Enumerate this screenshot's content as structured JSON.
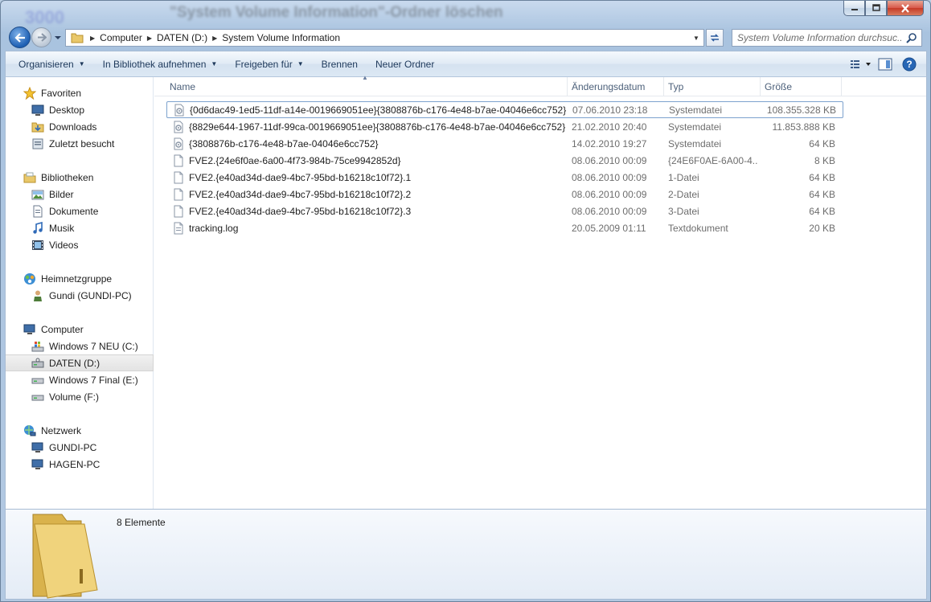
{
  "window": {
    "title": "\"System Volume Information\"-Ordner löschen",
    "background_logo": "3000"
  },
  "address": {
    "crumbs": [
      "Computer",
      "DATEN (D:)",
      "System Volume Information"
    ]
  },
  "search": {
    "placeholder": "System Volume Information durchsuc..."
  },
  "toolbar": {
    "items": [
      {
        "label": "Organisieren",
        "has_dropdown": true
      },
      {
        "label": "In Bibliothek aufnehmen",
        "has_dropdown": true
      },
      {
        "label": "Freigeben für",
        "has_dropdown": true
      },
      {
        "label": "Brennen",
        "has_dropdown": false
      },
      {
        "label": "Neuer Ordner",
        "has_dropdown": false
      }
    ]
  },
  "nav": {
    "favorites": {
      "label": "Favoriten",
      "items": [
        "Desktop",
        "Downloads",
        "Zuletzt besucht"
      ]
    },
    "libraries": {
      "label": "Bibliotheken",
      "items": [
        "Bilder",
        "Dokumente",
        "Musik",
        "Videos"
      ]
    },
    "homegroup": {
      "label": "Heimnetzgruppe",
      "items": [
        "Gundi (GUNDI-PC)"
      ]
    },
    "computer": {
      "label": "Computer",
      "items": [
        "Windows 7 NEU (C:)",
        "DATEN (D:)",
        "Windows 7 Final (E:)",
        "Volume (F:)"
      ],
      "selected": "DATEN (D:)"
    },
    "network": {
      "label": "Netzwerk",
      "items": [
        "GUNDI-PC",
        "HAGEN-PC"
      ]
    }
  },
  "columns": {
    "name": "Name",
    "date": "Änderungsdatum",
    "type": "Typ",
    "size": "Größe"
  },
  "files": [
    {
      "name": "{0d6dac49-1ed5-11df-a14e-0019669051ee}{3808876b-c176-4e48-b7ae-04046e6cc752}",
      "date": "07.06.2010 23:18",
      "type": "Systemdatei",
      "size": "108.355.328 KB",
      "icon": "system-file-icon"
    },
    {
      "name": "{8829e644-1967-11df-99ca-0019669051ee}{3808876b-c176-4e48-b7ae-04046e6cc752}",
      "date": "21.02.2010 20:40",
      "type": "Systemdatei",
      "size": "11.853.888 KB",
      "icon": "system-file-icon"
    },
    {
      "name": "{3808876b-c176-4e48-b7ae-04046e6cc752}",
      "date": "14.02.2010 19:27",
      "type": "Systemdatei",
      "size": "64 KB",
      "icon": "system-file-icon"
    },
    {
      "name": "FVE2.{24e6f0ae-6a00-4f73-984b-75ce9942852d}",
      "date": "08.06.2010 00:09",
      "type": "{24E6F0AE-6A00-4...",
      "size": "8 KB",
      "icon": "file-icon"
    },
    {
      "name": "FVE2.{e40ad34d-dae9-4bc7-95bd-b16218c10f72}.1",
      "date": "08.06.2010 00:09",
      "type": "1-Datei",
      "size": "64 KB",
      "icon": "file-icon"
    },
    {
      "name": "FVE2.{e40ad34d-dae9-4bc7-95bd-b16218c10f72}.2",
      "date": "08.06.2010 00:09",
      "type": "2-Datei",
      "size": "64 KB",
      "icon": "file-icon"
    },
    {
      "name": "FVE2.{e40ad34d-dae9-4bc7-95bd-b16218c10f72}.3",
      "date": "08.06.2010 00:09",
      "type": "3-Datei",
      "size": "64 KB",
      "icon": "file-icon"
    },
    {
      "name": "tracking.log",
      "date": "20.05.2009 01:11",
      "type": "Textdokument",
      "size": "20 KB",
      "icon": "text-file-icon"
    }
  ],
  "details": {
    "count_label": "8 Elemente"
  }
}
